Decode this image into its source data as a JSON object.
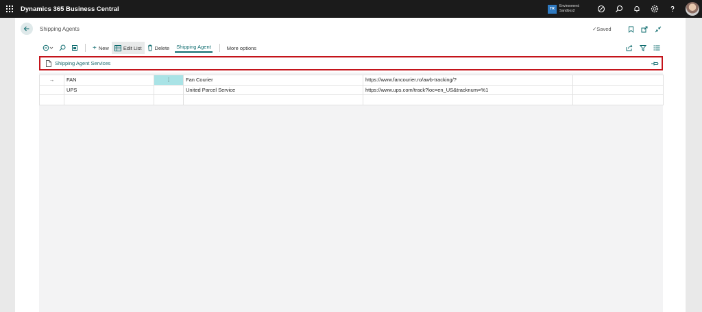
{
  "app": {
    "name": "Dynamics 365 Business Central",
    "environment": {
      "badge": "TR",
      "line1": "Environment:",
      "line2": "Sandbox2"
    }
  },
  "page": {
    "title": "Shipping Agents",
    "saved_label": "Saved"
  },
  "actions": {
    "new_label": "New",
    "edit_list_label": "Edit List",
    "delete_label": "Delete",
    "tab_label": "Shipping Agent",
    "more_options_label": "More options"
  },
  "part": {
    "label": "Shipping Agent Services"
  },
  "rows": [
    {
      "indicator": "→",
      "code": "FAN",
      "menu": "⋮",
      "name": "Fan Courier",
      "url": "https://www.fancourier.ro/awb-tracking/?"
    },
    {
      "indicator": "",
      "code": "UPS",
      "menu": "",
      "name": "United Parcel Service",
      "url": "https://www.ups.com/track?loc=en_US&tracknum=%1"
    },
    {
      "indicator": "",
      "code": "",
      "menu": "",
      "name": "",
      "url": ""
    }
  ],
  "colors": {
    "topbar": "#1b1b1b",
    "accent": "#0f6c6f",
    "highlight_border": "#c4141b",
    "selected_cell": "#a9e3e6"
  }
}
